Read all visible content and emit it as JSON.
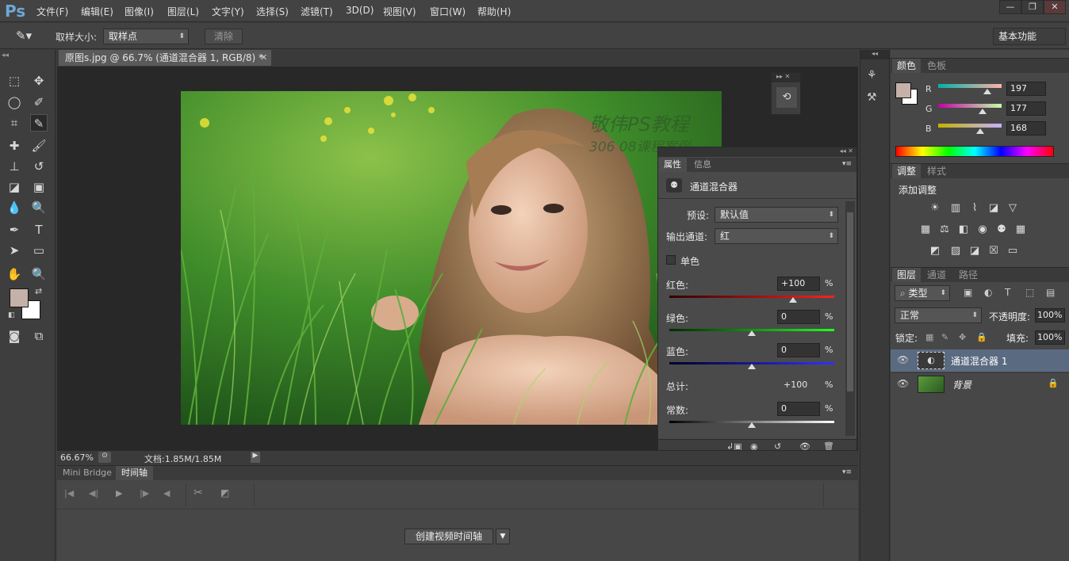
{
  "app": {
    "logo": "Ps"
  },
  "menu": [
    "文件(F)",
    "编辑(E)",
    "图像(I)",
    "图层(L)",
    "文字(Y)",
    "选择(S)",
    "滤镜(T)",
    "3D(D)",
    "视图(V)",
    "窗口(W)",
    "帮助(H)"
  ],
  "window_controls": {
    "minimize": "—",
    "restore": "❐",
    "close": "✕"
  },
  "options": {
    "sample_size_label": "取样大小:",
    "sample_size_value": "取样点",
    "clear_button": "清除",
    "workspace": "基本功能"
  },
  "document": {
    "tab_title": "原图s.jpg @ 66.7% (通道混合器 1, RGB/8) *",
    "watermark_line1": "敬伟PS教程",
    "watermark_line2": "306 08课程案例",
    "zoom": "66.67%",
    "doc_size": "文档:1.85M/1.85M"
  },
  "timeline": {
    "tabs": [
      "Mini Bridge",
      "时间轴"
    ],
    "create_button": "创建视频时间轴"
  },
  "properties": {
    "tabs": [
      "属性",
      "信息"
    ],
    "title": "通道混合器",
    "preset_label": "预设:",
    "preset_value": "默认值",
    "output_label": "输出通道:",
    "output_value": "红",
    "monochrome_label": "单色",
    "monochrome_checked": false,
    "red_label": "红色:",
    "red_value": "+100",
    "red_level": 100,
    "green_label": "绿色:",
    "green_value": "0",
    "green_level": 0,
    "blue_label": "蓝色:",
    "blue_value": "0",
    "blue_level": 0,
    "total_label": "总计:",
    "total_value": "+100",
    "constant_label": "常数:",
    "constant_value": "0",
    "constant_level": 0,
    "percent": "%"
  },
  "color_panel": {
    "tabs": [
      "颜色",
      "色板"
    ],
    "r_label": "R",
    "r_value": "197",
    "g_label": "G",
    "g_value": "177",
    "b_label": "B",
    "b_value": "168",
    "foreground": "#c5b1a8"
  },
  "adjustments": {
    "tabs": [
      "调整",
      "样式"
    ],
    "add_label": "添加调整"
  },
  "layers_panel": {
    "tabs": [
      "图层",
      "通道",
      "路径"
    ],
    "filter_kind": "类型",
    "blend_mode": "正常",
    "opacity_label": "不透明度:",
    "opacity_value": "100%",
    "lock_label": "锁定:",
    "fill_label": "填充:",
    "fill_value": "100%",
    "layers": [
      {
        "name": "通道混合器 1"
      },
      {
        "name": "背景"
      }
    ]
  }
}
